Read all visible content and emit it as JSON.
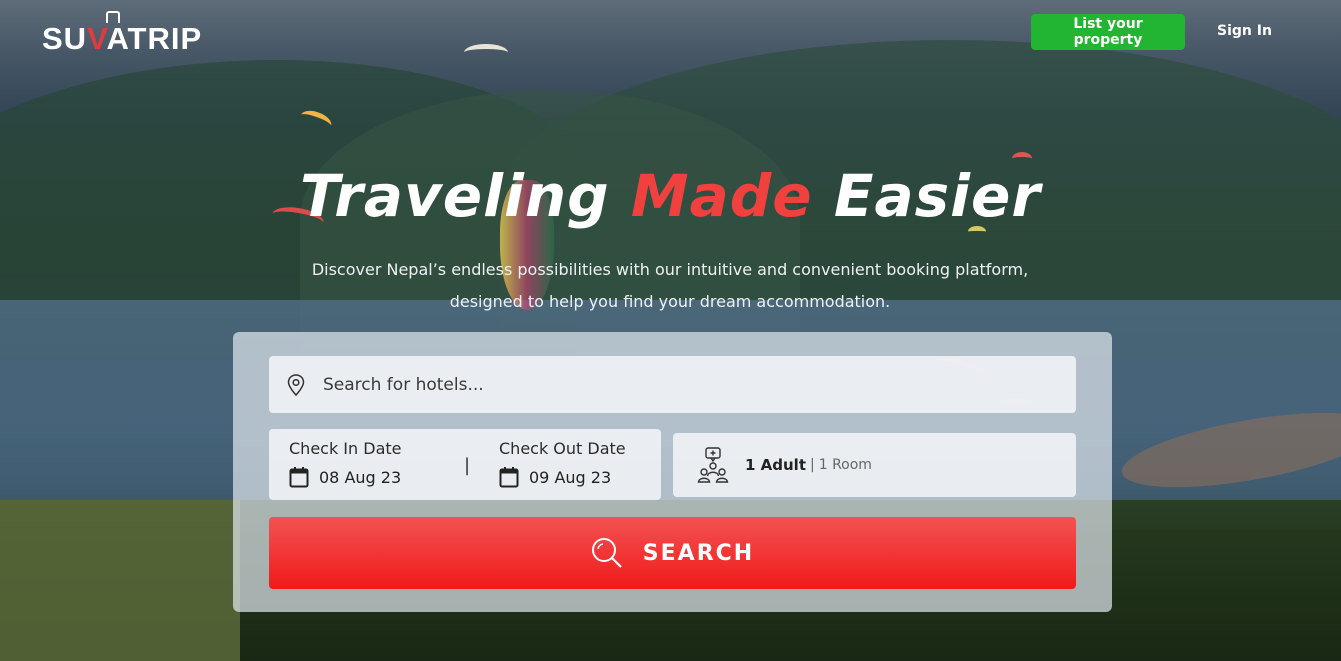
{
  "header": {
    "logo_prefix": "SU",
    "logo_accent": "V",
    "logo_suffix": "ATRIP",
    "list_property": "List your property",
    "sign_in": "Sign In"
  },
  "hero": {
    "title_part1": "Traveling",
    "title_accent": "Made",
    "title_part2": "Easier",
    "subtitle_line1": "Discover Nepal’s endless possibilities with our intuitive and convenient booking platform,",
    "subtitle_line2": "designed to help you find your dream accommodation."
  },
  "search": {
    "placeholder": "Search for hotels...",
    "check_in_label": "Check In Date",
    "check_in_value": "08 Aug 23",
    "separator": "|",
    "check_out_label": "Check Out Date",
    "check_out_value": "09 Aug 23",
    "guests_adult": "1 Adult",
    "guests_sep": "|",
    "guests_room": "1 Room",
    "button_label": "SEARCH"
  },
  "colors": {
    "accent": "#f0413f",
    "list_button": "#22b531",
    "search_button": "#f11a1a"
  },
  "icons": [
    "location-pin-icon",
    "calendar-icon",
    "guests-icon",
    "search-icon"
  ]
}
